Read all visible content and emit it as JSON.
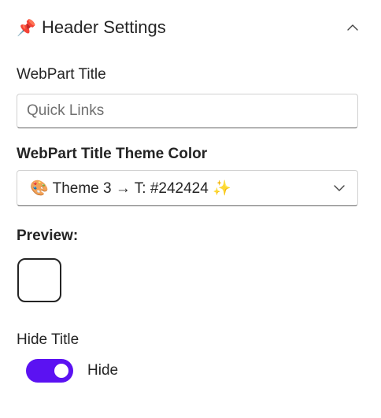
{
  "header": {
    "icon": "pushpin-icon",
    "icon_glyph": "📌",
    "title": "Header Settings",
    "expanded": true
  },
  "webpart_title": {
    "label": "WebPart Title",
    "value": "",
    "placeholder": "Quick Links"
  },
  "theme_color": {
    "label": "WebPart Title Theme Color",
    "selected": "🎨 Theme 3 → T: #242424 ✨"
  },
  "preview": {
    "label": "Preview:",
    "swatch_border_color": "#242424"
  },
  "hide_title": {
    "label": "Hide Title",
    "toggle_label": "Hide",
    "checked": true,
    "accent_color": "#5b12f2"
  }
}
